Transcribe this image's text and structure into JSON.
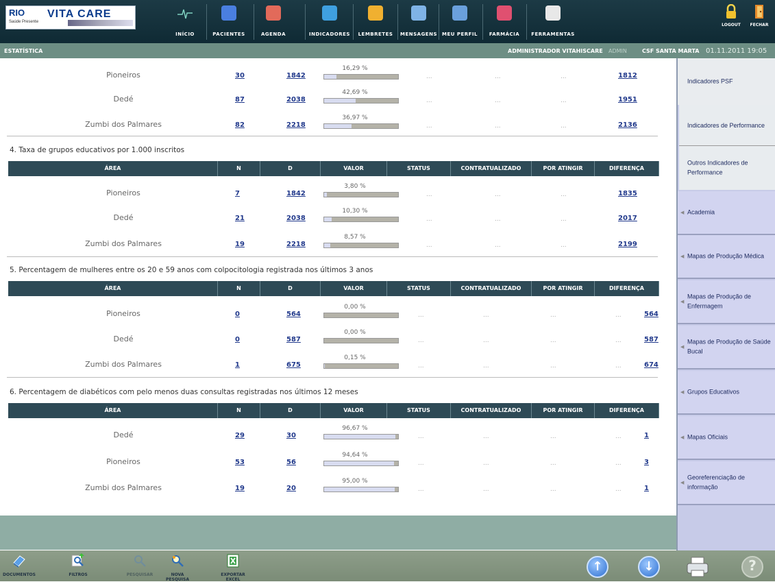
{
  "header": {
    "logo_rio": "RIO",
    "logo_vita": "VITA CARE",
    "logo_sub": "Saúde Presente",
    "nav": [
      {
        "label": "INÍCIO",
        "icon": "heartbeat-icon"
      },
      {
        "label": "PACIENTES",
        "icon": "patient-icon"
      },
      {
        "label": "AGENDA",
        "icon": "calendar-icon"
      },
      {
        "label": "INDICADORES",
        "icon": "pie-chart-icon"
      },
      {
        "label": "LEMBRETES",
        "icon": "reminder-icon"
      },
      {
        "label": "MENSAGENS",
        "icon": "envelope-icon"
      },
      {
        "label": "MEU PERFIL",
        "icon": "profile-card-icon"
      },
      {
        "label": "FARMÁCIA",
        "icon": "pill-icon"
      },
      {
        "label": "FERRAMENTAS",
        "icon": "tools-icon"
      }
    ],
    "logout": "LOGOUT",
    "fechar": "FECHAR"
  },
  "statusbar": {
    "section": "ESTATÍSTICA",
    "user": "ADMINISTRADOR VITAHISCARE",
    "role": "ADMIN",
    "unit": "CSF SANTA MARTA",
    "datetime": "01.11.2011 19:05"
  },
  "columns": [
    "ÁREA",
    "N",
    "D",
    "VALOR",
    "STATUS",
    "CONTRATUALIZADO",
    "POR ATINGIR",
    "DIFERENÇA"
  ],
  "dots": "...",
  "sections": [
    {
      "title": "",
      "rows": [
        {
          "area": "Pioneiros",
          "n": "30",
          "d": "1842",
          "valor": "16,29 %",
          "fill": 0.163,
          "dif": "1812"
        },
        {
          "area": "Dedé",
          "n": "87",
          "d": "2038",
          "valor": "42,69 %",
          "fill": 0.427,
          "dif": "1951"
        },
        {
          "area": "Zumbi dos Palmares",
          "n": "82",
          "d": "2218",
          "valor": "36,97 %",
          "fill": 0.37,
          "dif": "2136"
        }
      ]
    },
    {
      "title": "4. Taxa de grupos educativos por 1.000 inscritos",
      "rows": [
        {
          "area": "Pioneiros",
          "n": "7",
          "d": "1842",
          "valor": "3,80 %",
          "fill": 0.038,
          "dif": "1835"
        },
        {
          "area": "Dedé",
          "n": "21",
          "d": "2038",
          "valor": "10,30 %",
          "fill": 0.103,
          "dif": "2017"
        },
        {
          "area": "Zumbi dos Palmares",
          "n": "19",
          "d": "2218",
          "valor": "8,57 %",
          "fill": 0.086,
          "dif": "2199"
        }
      ]
    },
    {
      "title": "5. Percentagem de mulheres entre os 20 e 59 anos com colpocitologia registrada nos últimos 3 anos",
      "rows": [
        {
          "area": "Pioneiros",
          "n": "0",
          "d": "564",
          "valor": "0,00 %",
          "fill": 0.0,
          "dif": "564"
        },
        {
          "area": "Dedé",
          "n": "0",
          "d": "587",
          "valor": "0,00 %",
          "fill": 0.0,
          "dif": "587"
        },
        {
          "area": "Zumbi dos Palmares",
          "n": "1",
          "d": "675",
          "valor": "0,15 %",
          "fill": 0.0015,
          "dif": "674"
        }
      ]
    },
    {
      "title": "6. Percentagem de diabéticos com pelo menos duas consultas registradas nos últimos 12 meses",
      "rows": [
        {
          "area": "Dedé",
          "n": "29",
          "d": "30",
          "valor": "96,67 %",
          "fill": 0.967,
          "dif": "1"
        },
        {
          "area": "Pioneiros",
          "n": "53",
          "d": "56",
          "valor": "94,64 %",
          "fill": 0.946,
          "dif": "3"
        },
        {
          "area": "Zumbi dos Palmares",
          "n": "19",
          "d": "20",
          "valor": "95,00 %",
          "fill": 0.95,
          "dif": "1"
        }
      ]
    }
  ],
  "sidebar": {
    "active": "Indicadores PSF",
    "subitems": [
      "Indicadores de Performance",
      "Outros Indicadores de Performance"
    ],
    "items": [
      "Academia",
      "Mapas de Produção Médica",
      "Mapas de Produção de Enfermagem",
      "Mapas de Produção de Saúde Bucal",
      "Grupos Educativos",
      "Mapas Oficiais",
      "Georeferenciação de informação"
    ]
  },
  "toolbar": {
    "documentos": "DOCUMENTOS",
    "filtros": "FILTROS",
    "pesquisar": "PESQUISAR",
    "nova_pesquisa": "NOVA PESQUISA",
    "exportar_excel": "EXPORTAR EXCEL"
  },
  "colors": {
    "header_bg": "#163540",
    "status_bg": "#6d8e84",
    "table_head": "#2e4a56",
    "link": "#223a8c",
    "sidebar_bg": "#d2d4f0"
  }
}
